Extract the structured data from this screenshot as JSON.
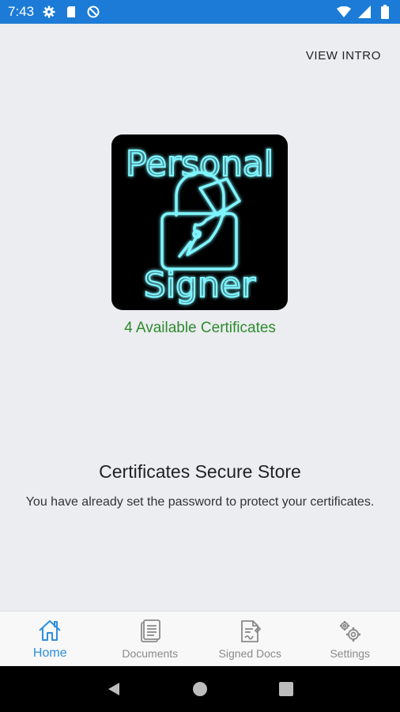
{
  "status_bar": {
    "time": "7:43",
    "left_icons": [
      "gear-icon",
      "sim-card-icon",
      "no-data-icon"
    ],
    "right_icons": [
      "wifi-icon",
      "signal-icon",
      "battery-icon"
    ]
  },
  "header": {
    "view_intro_label": "VIEW INTRO"
  },
  "logo": {
    "line1": "Personal",
    "line2": "Signer"
  },
  "certificates": {
    "count_text": "4 Available Certificates",
    "color": "#2e8b2e"
  },
  "store": {
    "title": "Certificates Secure Store",
    "description": "You have already set the password to protect your certificates."
  },
  "bottom_nav": {
    "items": [
      {
        "label": "Home",
        "icon": "home-icon",
        "active": true
      },
      {
        "label": "Documents",
        "icon": "documents-icon",
        "active": false
      },
      {
        "label": "Signed Docs",
        "icon": "signed-docs-icon",
        "active": false
      },
      {
        "label": "Settings",
        "icon": "settings-gears-icon",
        "active": false
      }
    ],
    "active_color": "#2d8fe0",
    "inactive_color": "#8a8a8a"
  },
  "android_nav": {
    "buttons": [
      "back-icon",
      "home-circle-icon",
      "recents-icon"
    ]
  }
}
